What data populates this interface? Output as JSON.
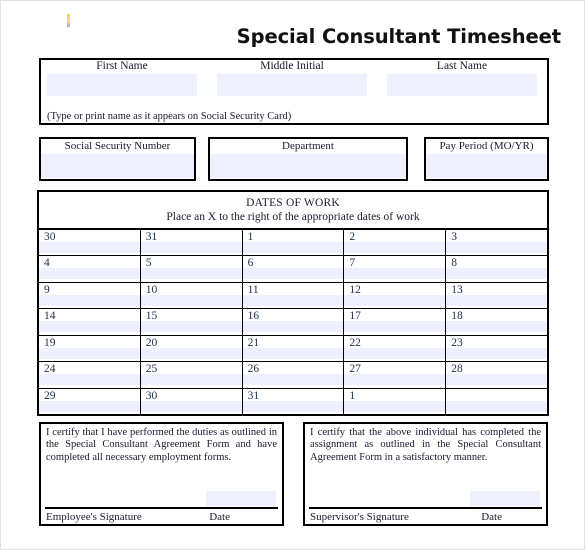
{
  "document": {
    "title": "Special Consultant Timesheet",
    "marker_color": "#f2cf54",
    "field_fill_color": "#eef0fd",
    "border_color": "#000000"
  },
  "name_section": {
    "fields": [
      {
        "label": "First Name",
        "value": ""
      },
      {
        "label": "Middle Initial",
        "value": ""
      },
      {
        "label": "Last Name",
        "value": ""
      }
    ],
    "note": "(Type or print name as it appears on Social Security Card)"
  },
  "info_section": {
    "fields": [
      {
        "label": "Social Security Number",
        "value": ""
      },
      {
        "label": "Department",
        "value": ""
      },
      {
        "label": "Pay Period (MO/YR)",
        "value": ""
      }
    ]
  },
  "dates_section": {
    "heading": "DATES OF WORK",
    "instruction": "Place an X to the right of the appropriate dates of work",
    "rows": [
      [
        "30",
        "31",
        "1",
        "2",
        "3"
      ],
      [
        "4",
        "5",
        "6",
        "7",
        "8"
      ],
      [
        "9",
        "10",
        "11",
        "12",
        "13"
      ],
      [
        "14",
        "15",
        "16",
        "17",
        "18"
      ],
      [
        "19",
        "20",
        "21",
        "22",
        "23"
      ],
      [
        "24",
        "25",
        "26",
        "27",
        "28"
      ],
      [
        "29",
        "30",
        "31",
        "1",
        ""
      ]
    ]
  },
  "certifications": {
    "employee": {
      "text": "I certify that I have performed the duties as outlined in the Special Consultant Agreement Form and have completed all necessary employment forms.",
      "signature_label": "Employee's Signature",
      "date_label": "Date",
      "date_value": ""
    },
    "supervisor": {
      "text": "I certify that the above individual has completed the assignment as outlined in the Special Consultant Agreement Form in a satisfactory manner.",
      "signature_label": "Supervisor's Signature",
      "date_label": "Date",
      "date_value": ""
    }
  }
}
